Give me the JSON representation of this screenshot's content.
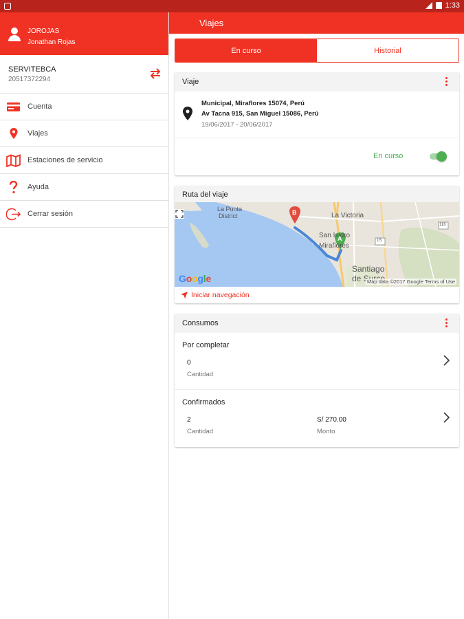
{
  "status_bar": {
    "time": "1:33"
  },
  "sidebar": {
    "username": "JOROJAS",
    "fullname": "Jonathan Rojas",
    "company_name": "SERVITEBCA",
    "company_ruc": "20517372294",
    "items": [
      {
        "label": "Cuenta",
        "icon": "credit-card-icon"
      },
      {
        "label": "Viajes",
        "icon": "location-pin-icon"
      },
      {
        "label": "Estaciones de servicio",
        "icon": "map-icon"
      },
      {
        "label": "Ayuda",
        "icon": "question-icon"
      },
      {
        "label": "Cerrar sesión",
        "icon": "logout-icon"
      }
    ]
  },
  "appbar": {
    "title": "Viajes"
  },
  "tabs": [
    {
      "label": "En curso",
      "active": true
    },
    {
      "label": "Historial",
      "active": false
    }
  ],
  "trip": {
    "header": "Viaje",
    "origin": "Municipal, Miraflores 15074, Perú",
    "destination": "Av Tacna 915, San Miguel 15086, Perú",
    "dates": "19/06/2017 - 20/06/2017",
    "status": "En curso",
    "toggle_on": true
  },
  "route": {
    "header": "Ruta del viaje",
    "map_labels": {
      "la_punta": "La Punta",
      "district": "District",
      "la_victoria": "La Victoria",
      "san_isidro": "San Isidro",
      "miraflores": "Miraflores",
      "santiago": "Santiago",
      "de_surco": "de Surco",
      "marker_a": "A",
      "marker_b": "B",
      "shield_1": "116",
      "shield_2": "1S"
    },
    "google": "Google",
    "attribution": "Map data ©2017 Google  Terms of Use",
    "nav_label": "Iniciar navegación"
  },
  "consumos": {
    "header": "Consumos",
    "pending": {
      "title": "Por completar",
      "quantity_value": "0",
      "quantity_label": "Cantidad"
    },
    "confirmed": {
      "title": "Confirmados",
      "quantity_value": "2",
      "quantity_label": "Cantidad",
      "amount_value": "S/ 270.00",
      "amount_label": "Monto"
    }
  },
  "colors": {
    "primary": "#f03224",
    "status_bar": "#b8241b",
    "success": "#4caf50"
  }
}
